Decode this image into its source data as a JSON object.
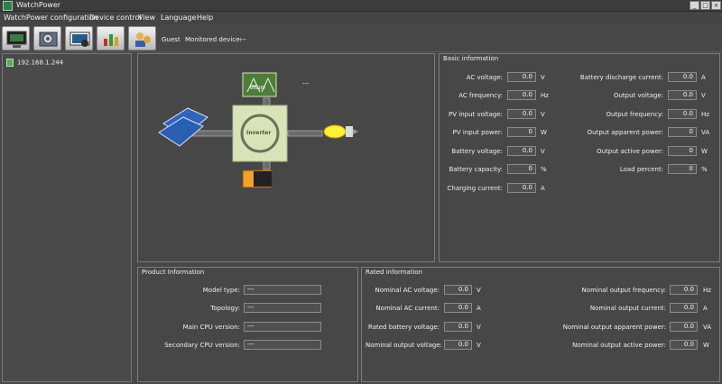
{
  "window": {
    "title": "WatchPower",
    "controls": [
      "_",
      "□",
      "×"
    ]
  },
  "menu": [
    "WatchPower configuration",
    "Device control",
    "View",
    "Language",
    "Help"
  ],
  "toolbar": {
    "buttons": [
      "monitor-icon",
      "configuration-icon",
      "device-control-icon",
      "chart-icon",
      "user-icon"
    ],
    "user": "Guest",
    "monitored_device_label": "Monitored device:",
    "monitored_device_value": "---"
  },
  "device_tree": {
    "items": [
      "192.168.1.244"
    ]
  },
  "diagram": {
    "grid_value": "---",
    "grid_label": "UTILITY",
    "inverter_label": "Inverter",
    "colors": {
      "grid": "#4c7d39",
      "inverter": "#d8e4b8",
      "battery": "#f0a22d",
      "bulb": "#ffee3a"
    }
  },
  "basic": {
    "title": "Basic information",
    "left": [
      {
        "label": "AC voltage:",
        "value": "0.0",
        "unit": "V"
      },
      {
        "label": "AC frequency:",
        "value": "0.0",
        "unit": "Hz"
      },
      {
        "label": "PV input voltage:",
        "value": "0.0",
        "unit": "V"
      },
      {
        "label": "PV input power:",
        "value": "0",
        "unit": "W"
      },
      {
        "label": "Battery voltage:",
        "value": "0.0",
        "unit": "V"
      },
      {
        "label": "Battery capacity:",
        "value": "0",
        "unit": "%"
      },
      {
        "label": "Charging current:",
        "value": "0.0",
        "unit": "A"
      }
    ],
    "right": [
      {
        "label": "Battery discharge current:",
        "value": "0.0",
        "unit": "A"
      },
      {
        "label": "Output voltage:",
        "value": "0.0",
        "unit": "V"
      },
      {
        "label": "Output frequency:",
        "value": "0.0",
        "unit": "Hz"
      },
      {
        "label": "Output apparent power:",
        "value": "0",
        "unit": "VA"
      },
      {
        "label": "Output active power:",
        "value": "0",
        "unit": "W"
      },
      {
        "label": "Load percent:",
        "value": "0",
        "unit": "%"
      }
    ]
  },
  "product": {
    "title": "Product Information",
    "rows": [
      {
        "label": "Model type:",
        "value": "---"
      },
      {
        "label": "Topology:",
        "value": "---"
      },
      {
        "label": "Main CPU version:",
        "value": "---"
      },
      {
        "label": "Secondary CPU version:",
        "value": "---"
      }
    ]
  },
  "rated": {
    "title": "Rated information",
    "left": [
      {
        "label": "Nominal AC voltage:",
        "value": "0.0",
        "unit": "V"
      },
      {
        "label": "Nominal AC current:",
        "value": "0.0",
        "unit": "A"
      },
      {
        "label": "Rated battery voltage:",
        "value": "0.0",
        "unit": "V"
      },
      {
        "label": "Nominal output voltage:",
        "value": "0.0",
        "unit": "V"
      }
    ],
    "right": [
      {
        "label": "Nominal output frequency:",
        "value": "0.0",
        "unit": "Hz"
      },
      {
        "label": "Nominal output current:",
        "value": "0.0",
        "unit": "A"
      },
      {
        "label": "Nominal output apparent power:",
        "value": "0.0",
        "unit": "VA"
      },
      {
        "label": "Nominal output active power:",
        "value": "0.0",
        "unit": "W"
      }
    ]
  }
}
